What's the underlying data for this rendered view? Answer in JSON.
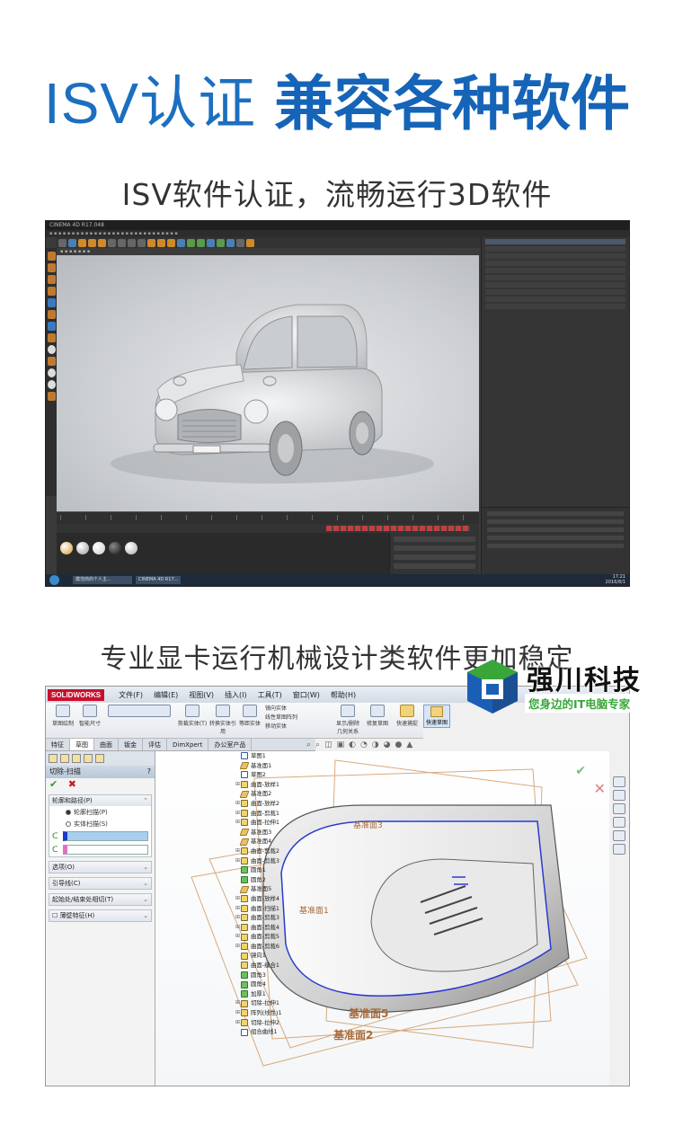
{
  "headline": {
    "light": "ISV认证",
    "bold": "兼容各种软件"
  },
  "section1": {
    "subtitle": "ISV软件认证，流畅运行3D软件"
  },
  "c4d": {
    "window_title": "CINEMA 4D R17.048",
    "taskbar_items": [
      "模范商的个人主...",
      "CINEMA 4D R17..."
    ],
    "clock_time": "17:21",
    "clock_date": "2016/8/1"
  },
  "section2": {
    "subtitle": "专业显卡运行机械设计类软件更加稳定"
  },
  "brand": {
    "name": "强川科技",
    "slogan": "您身边的IT电脑专家",
    "colors": {
      "blue": "#1a5fb4",
      "green": "#3aa63a"
    }
  },
  "solidworks": {
    "logo": "SOLIDWORKS",
    "menu": [
      "文件(F)",
      "编辑(E)",
      "视图(V)",
      "插入(I)",
      "工具(T)",
      "窗口(W)",
      "帮助(H)"
    ],
    "ribbon": {
      "sketch": "草图绘制",
      "smart_dim": "智能尺寸",
      "trim": "剪裁实体(T)",
      "convert": "转换实体引用",
      "offset": "等距实体",
      "mirror": "镜向实体",
      "linear_pattern": "线性草图阵列",
      "move": "移动实体",
      "display": "显示/删除几何关系",
      "repair": "修复草图",
      "quick_snap": "快速捕捉",
      "rapid_sketch": "快速草图"
    },
    "tabs": [
      "特征",
      "草图",
      "曲面",
      "钣金",
      "评估",
      "DimXpert",
      "办公室产品"
    ],
    "property_manager": {
      "title": "切除-扫描",
      "help": "?",
      "section_profile": "轮廓和路径(P)",
      "option_profile": "轮廓扫描(P)",
      "option_solid": "实体扫描(S)",
      "section_options": "选项(O)",
      "section_guides": "引导线(C)",
      "section_start_end": "起始处/结束处相切(T)",
      "section_thin": "薄壁特征(H)"
    },
    "tree": [
      "草图1",
      "基准面1",
      "草图2",
      "曲面-放样1",
      "基准面2",
      "曲面-放样2",
      "曲面-剪裁1",
      "曲面-拉伸1",
      "基准面3",
      "基准面4",
      "曲面-剪裁2",
      "曲面-剪裁3",
      "圆角1",
      "圆角2",
      "基准面5",
      "曲面-放样4",
      "曲面-扫描1",
      "曲面-剪裁3",
      "曲面-剪裁4",
      "曲面-剪裁5",
      "曲面-剪裁6",
      "镜向1",
      "曲面-缝合1",
      "圆角3",
      "圆角4",
      "加厚1",
      "切除-拉伸1",
      "阵列(线性)1",
      "切除-拉伸2",
      "组合曲线1"
    ],
    "plane_labels": [
      "基准面2",
      "基准面5",
      "基准面1",
      "基准面3"
    ]
  }
}
